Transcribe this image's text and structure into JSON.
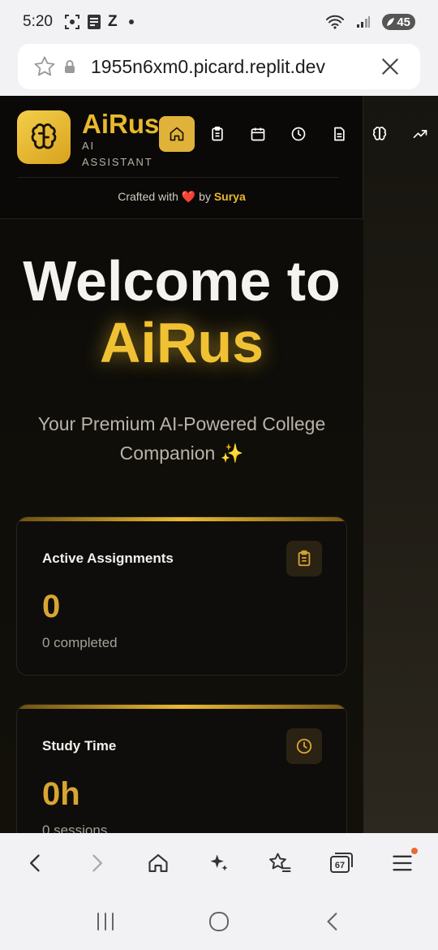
{
  "status_bar": {
    "time": "5:20",
    "z_label": "Z",
    "battery": "45"
  },
  "browser": {
    "url": "1955n6xm0.picard.replit.dev",
    "tab_count": "67"
  },
  "app": {
    "brand": "AiRus",
    "brand_sub": "AI ASSISTANT",
    "crafted_prefix": "Crafted with",
    "crafted_by": "by",
    "author": "Surya",
    "nav": [
      "home-icon",
      "clipboard-icon",
      "calendar-icon",
      "clock-icon",
      "document-icon",
      "brain-icon",
      "trending-icon"
    ],
    "accent_color": "#e0b23a"
  },
  "hero": {
    "welcome": "Welcome to",
    "accent": "AiRus",
    "tagline": "Your Premium AI-Powered College Companion ✨"
  },
  "cards": [
    {
      "title": "Active Assignments",
      "value": "0",
      "sub": "0 completed",
      "icon": "clipboard-icon"
    },
    {
      "title": "Study Time",
      "value": "0h",
      "sub": "0 sessions",
      "icon": "clock-icon"
    }
  ]
}
